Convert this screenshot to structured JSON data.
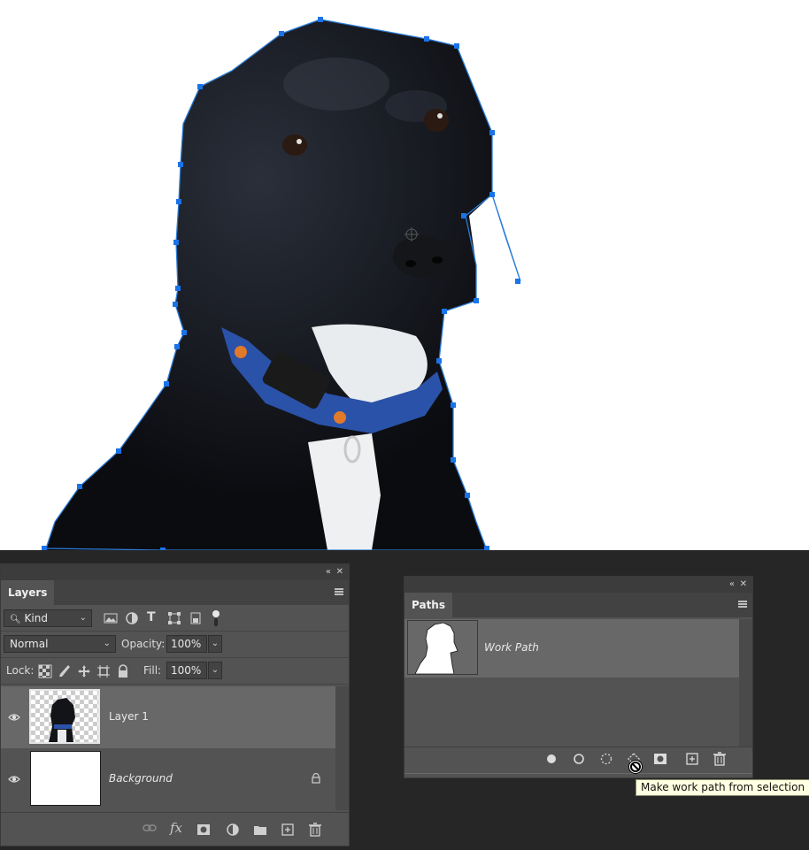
{
  "layers_panel": {
    "tab_label": "Layers",
    "filter": {
      "selected": "Kind"
    },
    "blend_mode": {
      "selected": "Normal"
    },
    "opacity": {
      "label": "Opacity:",
      "value": "100%"
    },
    "lock": {
      "label": "Lock:"
    },
    "fill": {
      "label": "Fill:",
      "value": "100%"
    },
    "layers": [
      {
        "name": "Layer 1",
        "selected": true
      },
      {
        "name": "Background",
        "italic": true,
        "locked": true
      }
    ],
    "footer_icons": [
      "link-icon",
      "fx-icon",
      "mask-icon",
      "adjustment-icon",
      "folder-icon",
      "new-layer-icon",
      "trash-icon"
    ],
    "fx_label": "fx"
  },
  "paths_panel": {
    "tab_label": "Paths",
    "paths": [
      {
        "name": "Work Path",
        "italic": true
      }
    ],
    "footer_icons": [
      "fill-path-icon",
      "stroke-path-icon",
      "load-selection-icon",
      "make-work-path-icon",
      "add-mask-icon",
      "new-path-icon",
      "trash-icon"
    ]
  },
  "tooltip": {
    "text": "Make work path from selection"
  },
  "colors": {
    "path_stroke": "#2b7bd6",
    "anchor": "#1a73e8",
    "panel_bg": "#535353",
    "app_bg": "#262626",
    "tooltip_bg": "#ffffe1"
  }
}
